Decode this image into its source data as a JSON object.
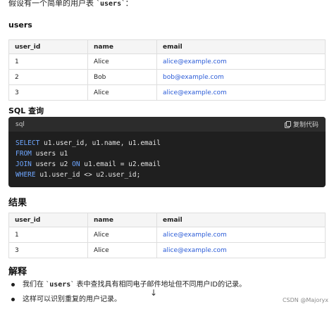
{
  "intro": {
    "prefix": "假设有一个简单的用户表 `",
    "table_name": "users",
    "suffix": "`："
  },
  "users_heading": "users",
  "columns": [
    "user_id",
    "name",
    "email"
  ],
  "users_rows": [
    [
      "1",
      "Alice",
      "alice@example.com"
    ],
    [
      "2",
      "Bob",
      "bob@example.com"
    ],
    [
      "3",
      "Alice",
      "alice@example.com"
    ]
  ],
  "sql_heading": "SQL 查询",
  "code": {
    "language": "sql",
    "copy_label": "复制代码",
    "lines": [
      [
        {
          "t": "SELECT",
          "k": true
        },
        {
          "t": " u1.user_id, u1.name, u1.email",
          "k": false
        }
      ],
      [
        {
          "t": "FROM",
          "k": true
        },
        {
          "t": " users u1",
          "k": false
        }
      ],
      [
        {
          "t": "JOIN",
          "k": true
        },
        {
          "t": " users u2 ",
          "k": false
        },
        {
          "t": "ON",
          "k": true
        },
        {
          "t": " u1.email = u2.email",
          "k": false
        }
      ],
      [
        {
          "t": "WHERE",
          "k": true
        },
        {
          "t": " u1.user_id <> u2.user_id;",
          "k": false
        }
      ]
    ]
  },
  "result_heading": "结果",
  "result_rows": [
    [
      "1",
      "Alice",
      "alice@example.com"
    ],
    [
      "3",
      "Alice",
      "alice@example.com"
    ]
  ],
  "explain_heading": "解释",
  "notes": {
    "first_prefix": "我们在 `",
    "first_code": "users",
    "first_suffix": "` 表中查找具有相同电子邮件地址但不同用户ID的记录。",
    "second": "这样可以识别重复的用户记录。"
  },
  "scroll_arrow": "↓",
  "watermark": "CSDN @Majoryx"
}
